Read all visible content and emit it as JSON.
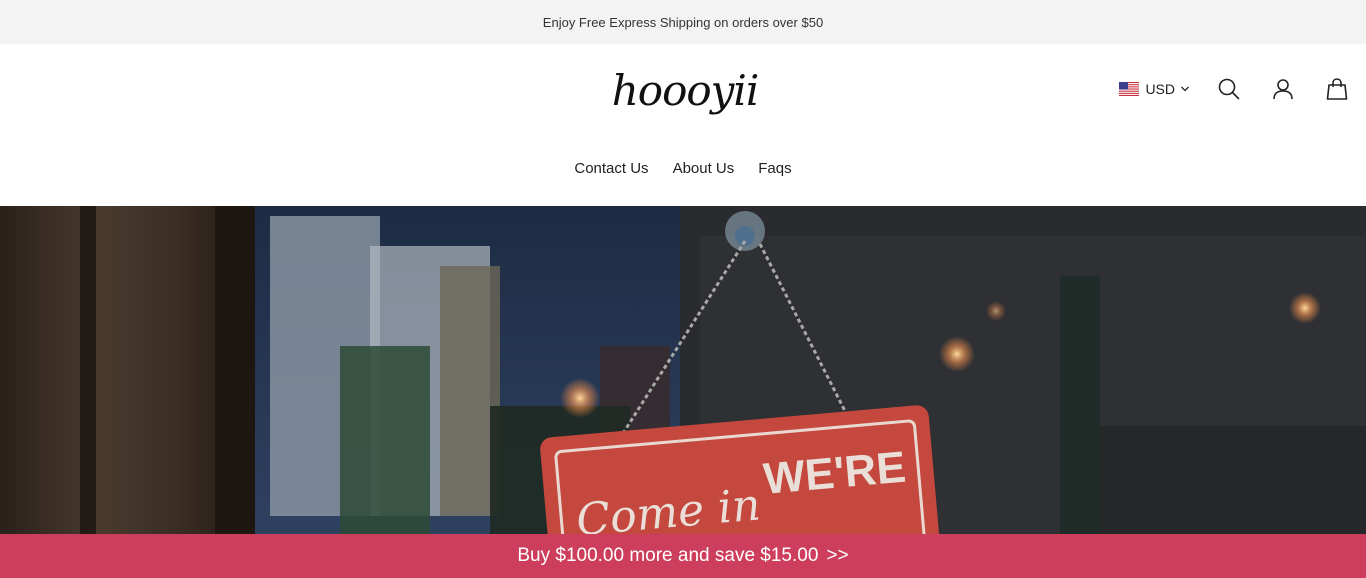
{
  "announcement": {
    "text": "Enjoy Free Express Shipping on orders over $50"
  },
  "header": {
    "logo_text": "hoooyii",
    "currency": {
      "code": "USD",
      "flag_icon": "us-flag-icon"
    },
    "icons": [
      "search-icon",
      "account-icon",
      "cart-icon"
    ]
  },
  "nav": {
    "items": [
      {
        "label": "Contact Us"
      },
      {
        "label": "About Us"
      },
      {
        "label": "Faqs"
      }
    ]
  },
  "hero": {
    "sign_text_1": "Come in",
    "sign_text_2": "WE'RE"
  },
  "promo_bar": {
    "text": "Buy $100.00 more and save $15.00",
    "arrow": ">>",
    "color": "#cc3e5c"
  }
}
